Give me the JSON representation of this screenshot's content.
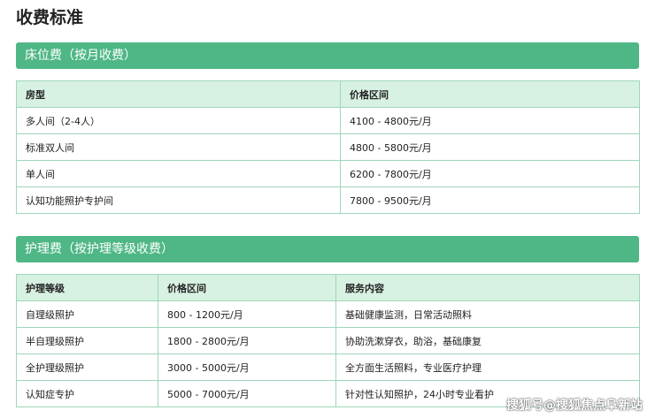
{
  "page_title": "收费标准",
  "bed_fee": {
    "title": "床位费（按月收费）",
    "headers": [
      "房型",
      "价格区间"
    ],
    "rows": [
      [
        "多人间（2-4人）",
        "4100 - 4800元/月"
      ],
      [
        "标准双人间",
        "4800 - 5800元/月"
      ],
      [
        "单人间",
        "6200 - 7800元/月"
      ],
      [
        "认知功能照护专护间",
        "7800 - 9500元/月"
      ]
    ]
  },
  "care_fee": {
    "title": "护理费（按护理等级收费）",
    "headers": [
      "护理等级",
      "价格区间",
      "服务内容"
    ],
    "rows": [
      [
        "自理级照护",
        "800 - 1200元/月",
        "基础健康监测，日常活动照料"
      ],
      [
        "半自理级照护",
        "1800 - 2800元/月",
        "协助洗漱穿衣，助浴，基础康复"
      ],
      [
        "全护理级照护",
        "3000 - 5000元/月",
        "全方面生活照料，专业医疗护理"
      ],
      [
        "认知症专护",
        "5000 - 7000元/月",
        "针对性认知照护，24小时专业看护"
      ]
    ]
  },
  "watermark": "搜狐号@搜狐焦点阜新站",
  "colors": {
    "header_green": "#4fb786",
    "table_header_bg": "#d7f1e2",
    "border": "#9fd6b9"
  }
}
